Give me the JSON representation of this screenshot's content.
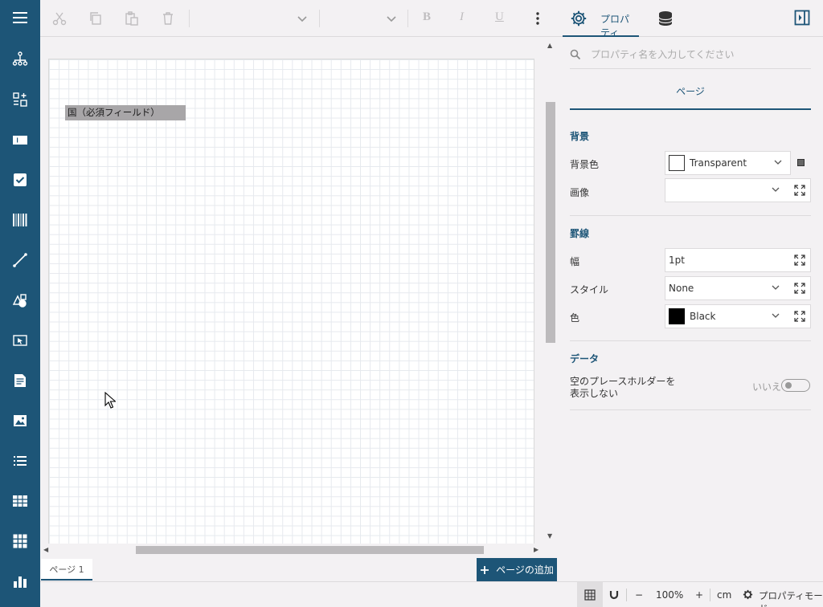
{
  "sidebar": {
    "items": [
      {
        "name": "menu-icon"
      },
      {
        "name": "report-tree-icon"
      },
      {
        "name": "component-icon"
      },
      {
        "name": "textbox-icon"
      },
      {
        "name": "checkbox-icon"
      },
      {
        "name": "barcode-icon"
      },
      {
        "name": "line-icon"
      },
      {
        "name": "shapes-icon"
      },
      {
        "name": "input-field-icon"
      },
      {
        "name": "rich-text-icon"
      },
      {
        "name": "image-icon"
      },
      {
        "name": "list-icon"
      },
      {
        "name": "table-icon"
      },
      {
        "name": "tablix-icon"
      },
      {
        "name": "chart-icon"
      }
    ]
  },
  "toolbar": {
    "bold": "B",
    "italic": "I",
    "underline": "U"
  },
  "canvas": {
    "field_label": "国（必須フィールド）"
  },
  "pages": {
    "tab_label": "ページ 1",
    "add_label": "ページの追加"
  },
  "status": {
    "zoom": "100%",
    "unit": "cm",
    "mode": "プロパティモード",
    "minus": "−",
    "plus": "+"
  },
  "panel": {
    "tab_label": "プロパティ",
    "search_placeholder": "プロパティ名を入力してください",
    "section": "ページ",
    "categories": {
      "background": "背景",
      "border": "罫線",
      "data": "データ"
    },
    "props": {
      "bg_color_label": "背景色",
      "bg_color_value": "Transparent",
      "image_label": "画像",
      "image_value": "",
      "width_label": "幅",
      "width_value": "1pt",
      "style_label": "スタイル",
      "style_value": "None",
      "color_label": "色",
      "color_value": "Black",
      "hide_placeholder_line1": "空のプレースホルダーを",
      "hide_placeholder_line2": "表示しない",
      "toggle_value": "いいえ"
    }
  },
  "colors": {
    "accent": "#1d5577",
    "sidebar": "#1d5577",
    "black": "#000000",
    "transparent": "#ffffff"
  }
}
